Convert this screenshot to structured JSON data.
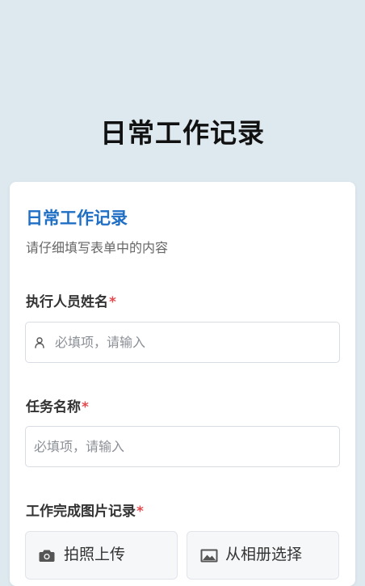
{
  "page": {
    "title": "日常工作记录"
  },
  "form": {
    "title": "日常工作记录",
    "description": "请仔细填写表单中的内容",
    "fields": [
      {
        "label": "执行人员姓名",
        "required_mark": "*",
        "placeholder": "必填项，请输入",
        "value": "",
        "icon": "user-icon"
      },
      {
        "label": "任务名称",
        "required_mark": "*",
        "placeholder": "必填项，请输入",
        "value": ""
      },
      {
        "label": "工作完成图片记录",
        "required_mark": "*"
      }
    ],
    "upload": {
      "camera_label": "拍照上传",
      "camera_icon": "camera-icon",
      "album_label": "从相册选择",
      "album_icon": "image-icon"
    }
  },
  "colors": {
    "background": "#dde8ef",
    "accent": "#1f6fc5",
    "required": "#e5484d"
  }
}
